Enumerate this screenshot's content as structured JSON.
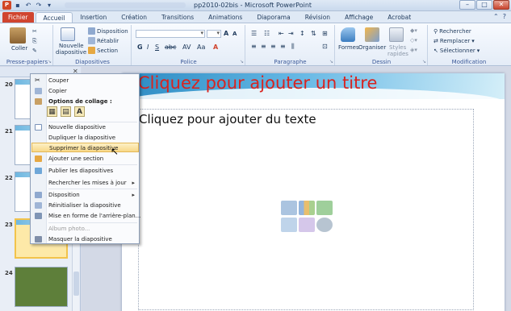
{
  "window": {
    "title": "pp2010-02bis - Microsoft PowerPoint"
  },
  "tabs": [
    "Fichier",
    "Accueil",
    "Insertion",
    "Création",
    "Transitions",
    "Animations",
    "Diaporama",
    "Révision",
    "Affichage",
    "Acrobat"
  ],
  "ribbon": {
    "groups": {
      "clipboard": "Presse-papiers",
      "slides": "Diapositives",
      "font": "Police",
      "paragraph": "Paragraphe",
      "drawing": "Dessin",
      "editing": "Modification"
    },
    "coller": "Coller",
    "nouvelle_diapo": "Nouvelle",
    "nouvelle_diapo2": "diapositive",
    "disposition": "Disposition",
    "retablir": "Rétablir",
    "section": "Section",
    "formes": "Formes",
    "organiser": "Organiser",
    "styles_rapides": "Styles",
    "styles_rapides2": "rapides",
    "rechercher": "Rechercher",
    "remplacer": "Remplacer",
    "selectionner": "Sélectionner"
  },
  "slide_numbers": [
    "20",
    "21",
    "22",
    "23",
    "24"
  ],
  "slide": {
    "title_placeholder": "Cliquez pour ajouter un titre",
    "body_placeholder": "Cliquez pour ajouter du texte"
  },
  "context_menu": {
    "items": [
      {
        "label": "Couper"
      },
      {
        "label": "Copier"
      },
      {
        "label": "Options de collage :"
      },
      {
        "label": "Nouvelle diapositive"
      },
      {
        "label": "Dupliquer la diapositive"
      },
      {
        "label": "Supprimer la diapositive"
      },
      {
        "label": "Ajouter une section"
      },
      {
        "label": "Publier les diapositives"
      },
      {
        "label": "Rechercher les mises à jour"
      },
      {
        "label": "Disposition"
      },
      {
        "label": "Réinitialiser la diapositive"
      },
      {
        "label": "Mise en forme de l'arrière-plan..."
      },
      {
        "label": "Album photo..."
      },
      {
        "label": "Masquer la diapositive"
      }
    ],
    "paste_letter": "A",
    "highlighted_index": 5
  }
}
